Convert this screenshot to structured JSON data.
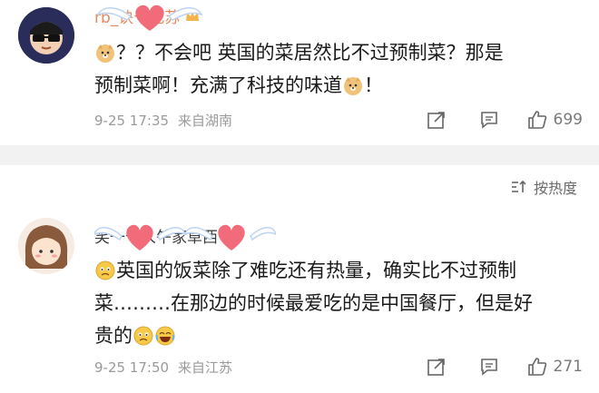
{
  "comments": [
    {
      "username": "rb_诀十色苏",
      "text_parts": [
        "？？不会吧 英国的菜居然比不过预制菜？那是\n预制菜啊！充满了科技的味道",
        "！"
      ],
      "time": "9-25 17:35",
      "location": "来自湖南",
      "likes": "699"
    },
    {
      "username": "笑一个人午家草西",
      "text_parts": [
        "英国的饭菜除了难吃还有热量，确实比不过预制\n菜………在那边的时候最爱吃的是中国餐厅，但是好\n贵的"
      ],
      "time": "9-25 17:50",
      "location": "来自江苏",
      "likes": "271"
    }
  ],
  "sort": {
    "label": "按热度"
  },
  "icons": {
    "share": "share-icon",
    "comment": "comment-icon",
    "like": "like-icon",
    "sort": "sort-icon",
    "doge": "doge-emoji",
    "sad": "sad-emoji",
    "laugh": "laugh-emoji"
  },
  "colors": {
    "username": "#e9895e",
    "heart": "#f26b7a",
    "meta": "#9a9a9a",
    "divider": "#f2f2f2"
  }
}
